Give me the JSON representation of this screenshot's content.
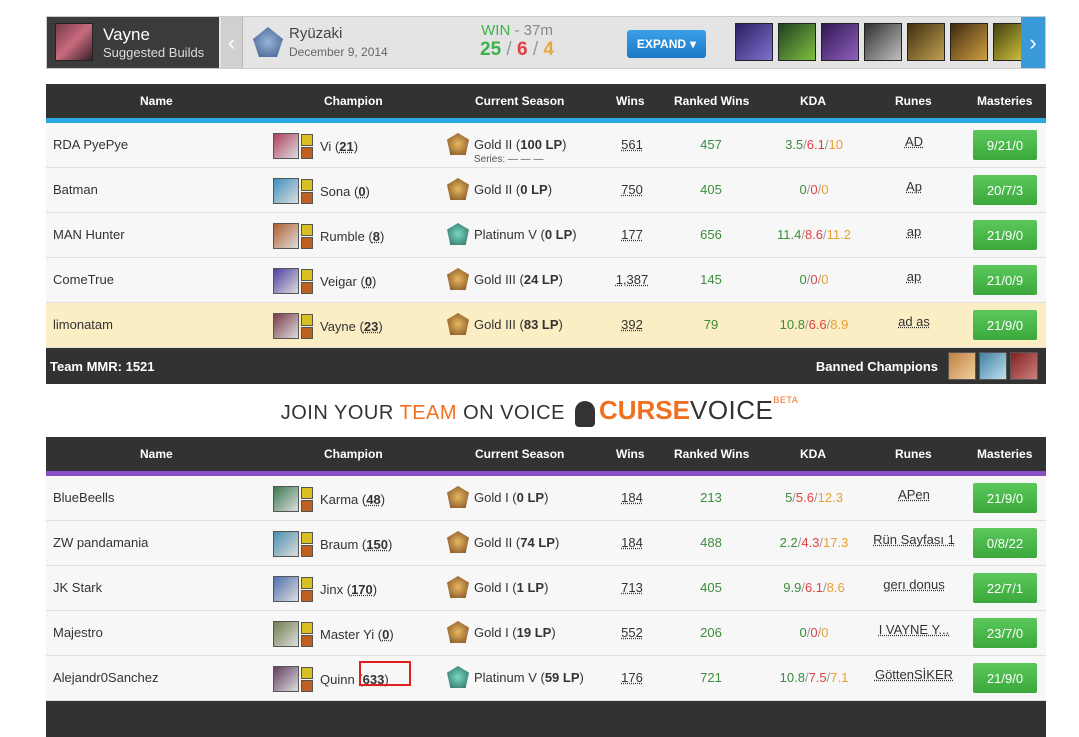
{
  "header": {
    "champion": "Vayne",
    "subtitle": "Suggested Builds",
    "player": "Ryüzaki",
    "date": "December 9, 2014",
    "result": "WIN",
    "duration": "37m",
    "kills": "25",
    "deaths": "6",
    "assists": "4",
    "expand": "EXPAND"
  },
  "columns": {
    "name": "Name",
    "champion": "Champion",
    "season": "Current Season",
    "wins": "Wins",
    "ranked": "Ranked Wins",
    "kda": "KDA",
    "runes": "Runes",
    "masteries": "Masteries"
  },
  "team1": {
    "accent": "#2aa8e0",
    "mmr": "Team MMR: 1521",
    "banned": "Banned Champions",
    "series_label": "Series:",
    "rows": [
      {
        "name": "RDA PyePye",
        "champ": "Vi",
        "games": "21",
        "tier": "Gold II",
        "lp": "100 LP",
        "medal": "gold",
        "wins": "561",
        "ranked": "457",
        "k": "3.5",
        "d": "6.1",
        "a": "10",
        "runes": "AD",
        "mast": "9/21/0",
        "c": "#b04060",
        "series": true
      },
      {
        "name": "Batman",
        "champ": "Sona",
        "games": "0",
        "tier": "Gold II",
        "lp": "0 LP",
        "medal": "gold",
        "wins": "750",
        "ranked": "405",
        "k": "0",
        "d": "0",
        "a": "0",
        "runes": "Ap",
        "mast": "20/7/3",
        "c": "#4090c0"
      },
      {
        "name": "MAN Hunter",
        "champ": "Rumble",
        "games": "8",
        "tier": "Platinum V",
        "lp": "0 LP",
        "medal": "plat",
        "wins": "177",
        "ranked": "656",
        "k": "11.4",
        "d": "8.6",
        "a": "11.2",
        "runes": "ap",
        "mast": "21/9/0",
        "c": "#b06030"
      },
      {
        "name": "ComeTrue",
        "champ": "Veigar",
        "games": "0",
        "tier": "Gold III",
        "lp": "24 LP",
        "medal": "gold",
        "wins": "1,387",
        "ranked": "145",
        "k": "0",
        "d": "0",
        "a": "0",
        "runes": "ap",
        "mast": "21/0/9",
        "c": "#5040a0"
      },
      {
        "name": "limonatam",
        "champ": "Vayne",
        "games": "23",
        "tier": "Gold III",
        "lp": "83 LP",
        "medal": "gold",
        "wins": "392",
        "ranked": "79",
        "k": "10.8",
        "d": "6.6",
        "a": "8.9",
        "runes": "ad as",
        "mast": "21/9/0",
        "c": "#7a3b4a",
        "hl": true
      }
    ]
  },
  "promo": {
    "a": "JOIN YOUR",
    "b": "TEAM",
    "c": "ON VOICE",
    "curse": "CURSE",
    "voice": "VOICE",
    "beta": "BETA"
  },
  "team2": {
    "accent": "#8a50c8",
    "rows": [
      {
        "name": "BlueBeells",
        "champ": "Karma",
        "games": "48",
        "tier": "Gold I",
        "lp": "0 LP",
        "medal": "gold",
        "wins": "184",
        "ranked": "213",
        "k": "5",
        "d": "5.6",
        "a": "12.3",
        "runes": "APen",
        "mast": "21/9/0",
        "c": "#3a7a50"
      },
      {
        "name": "ZW pandamania",
        "champ": "Braum",
        "games": "150",
        "tier": "Gold II",
        "lp": "74 LP",
        "medal": "gold",
        "wins": "184",
        "ranked": "488",
        "k": "2.2",
        "d": "4.3",
        "a": "17.3",
        "runes": "Rün Sayfası 1",
        "mast": "0/8/22",
        "c": "#4a90b0"
      },
      {
        "name": "JK Stark",
        "champ": "Jinx",
        "games": "170",
        "tier": "Gold I",
        "lp": "1 LP",
        "medal": "gold",
        "wins": "713",
        "ranked": "405",
        "k": "9.9",
        "d": "6.1",
        "a": "8.6",
        "runes": "gerı donus",
        "mast": "22/7/1",
        "c": "#5070b0"
      },
      {
        "name": "Majestro",
        "champ": "Master Yi",
        "games": "0",
        "tier": "Gold I",
        "lp": "19 LP",
        "medal": "gold",
        "wins": "552",
        "ranked": "206",
        "k": "0",
        "d": "0",
        "a": "0",
        "runes": "I VAYNE Y...",
        "mast": "23/7/0",
        "c": "#708050"
      },
      {
        "name": "Alejandr0Sanchez",
        "champ": "Quinn",
        "games": "633",
        "tier": "Platinum V",
        "lp": "59 LP",
        "medal": "plat",
        "wins": "176",
        "ranked": "721",
        "k": "10.8",
        "d": "7.5",
        "a": "7.1",
        "runes": "GöttenSİKER",
        "mast": "21/9/0",
        "c": "#604060"
      }
    ]
  }
}
